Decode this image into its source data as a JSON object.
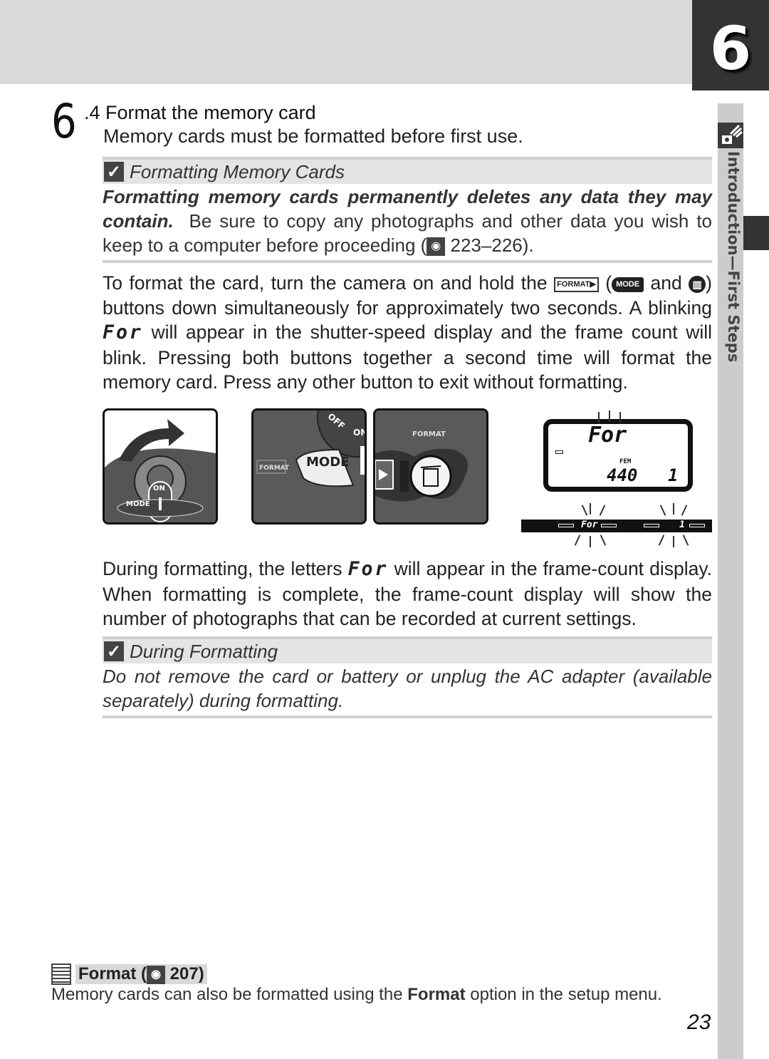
{
  "chapter": {
    "number": "6",
    "side_label": "Introduction—First Steps"
  },
  "step": {
    "big_number": "6",
    "title": ".4 Format the memory card",
    "subtitle": "Memory cards must be formatted before first use."
  },
  "note1": {
    "title": "Formatting Memory Cards",
    "bold_italic": "Formatting memory cards permanently deletes any data they may contain.",
    "text": "Be sure to copy any photographs and other data you wish to keep to a computer before proceeding (",
    "ref": "223–226",
    "close": ")."
  },
  "para1": {
    "t1": "To format the card, turn the camera on and hold the",
    "format_btn": "FORMAT▶",
    "t2": "(",
    "mode_btn": "MODE",
    "t3": "and",
    "trash_btn": "🗑",
    "t4": ") buttons down simultaneously for approximately two seconds.  A blinking",
    "lcd_for": "For",
    "t5": "will appear in the shutter-speed display and the frame count will blink.  Pressing both buttons together a second time will format the memory card.  Press any other button to exit without formatting."
  },
  "figures": {
    "fig1_labels": [
      "ON",
      "MODE",
      "FORMAT"
    ],
    "fig2_labels": [
      "MODE",
      "FORMAT",
      "OFF",
      "ON"
    ],
    "fig3_labels": [
      "FORMAT"
    ],
    "lcd": {
      "top": "For",
      "fem": "FEM",
      "count": "440",
      "frame": "1",
      "bar_left": "For",
      "bar_right": "1"
    }
  },
  "para2": {
    "t1": "During formatting, the letters",
    "lcd_for": "For",
    "t2": "will appear in the frame-count display.  When formatting is complete, the frame-count display will show the number of photographs that can be recorded at current settings."
  },
  "note2": {
    "title": "During Formatting",
    "body": "Do not remove the card or battery or unplug the AC adapter (available separately) during formatting."
  },
  "tip": {
    "title": "Format (",
    "ref": "207",
    "close": ")",
    "body_1": "Memory cards can also be formatted using the ",
    "body_bold": "Format",
    "body_2": " option in the setup menu."
  },
  "page_number": "23"
}
